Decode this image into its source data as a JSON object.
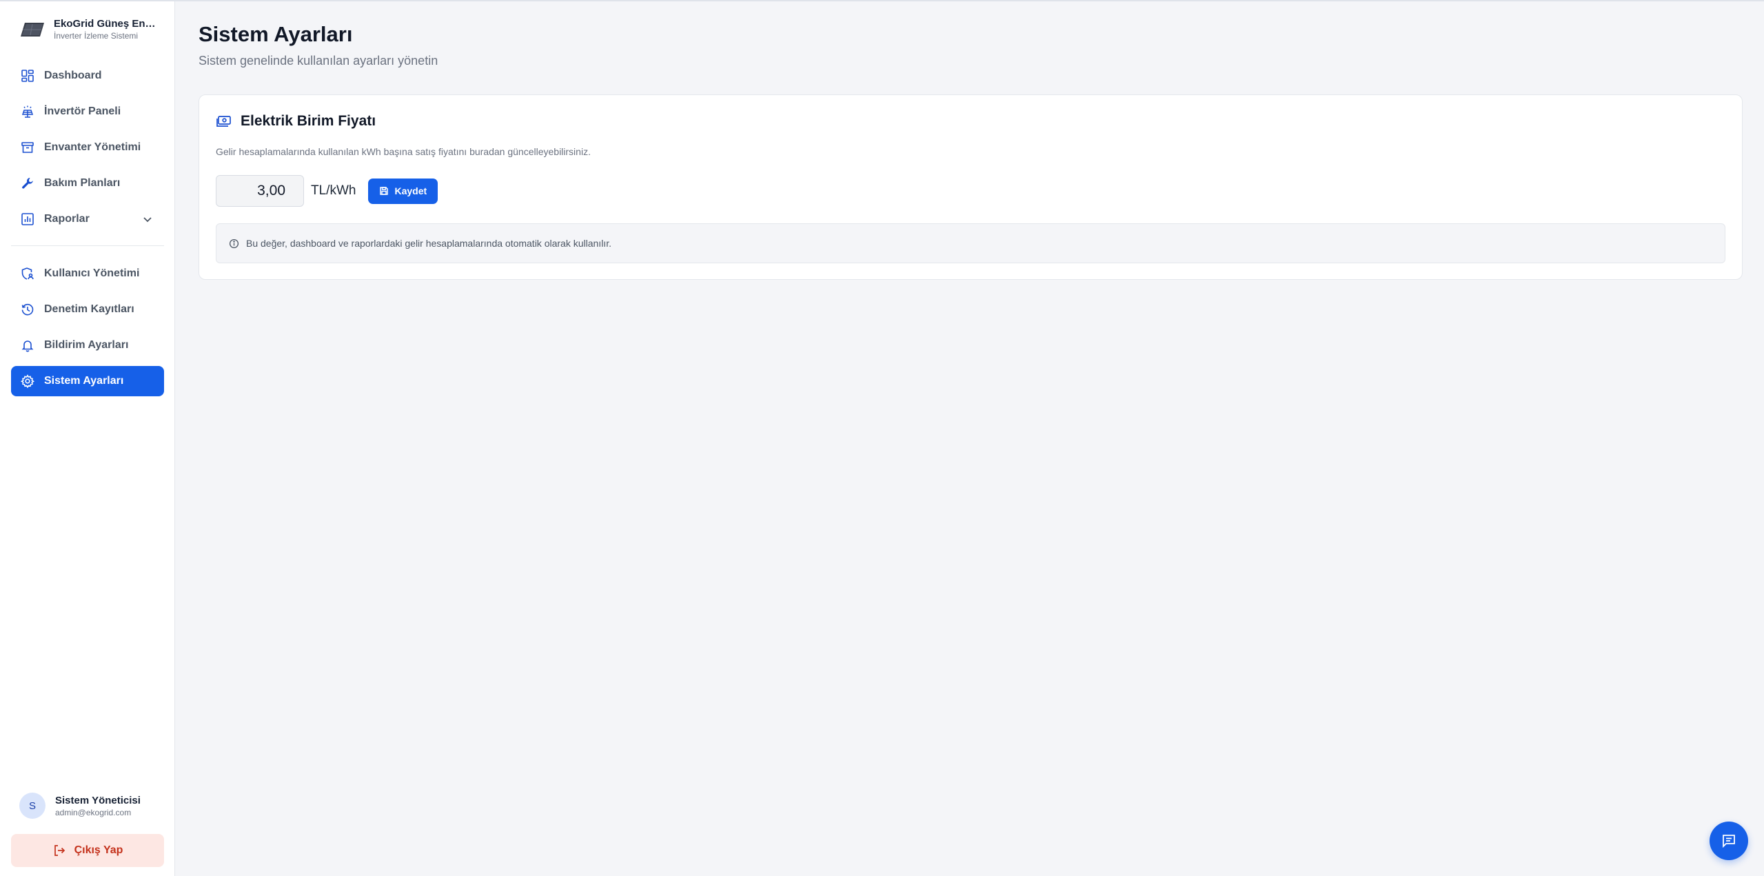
{
  "brand": {
    "title": "EkoGrid Güneş Enerji",
    "subtitle": "İnverter İzleme Sistemi"
  },
  "nav": {
    "items": [
      {
        "label": "Dashboard",
        "icon": "dashboard-icon"
      },
      {
        "label": "İnvertör Paneli",
        "icon": "solar-panel-icon"
      },
      {
        "label": "Envanter Yönetimi",
        "icon": "archive-icon"
      },
      {
        "label": "Bakım Planları",
        "icon": "wrench-icon"
      },
      {
        "label": "Raporlar",
        "icon": "chart-icon"
      }
    ],
    "admin_items": [
      {
        "label": "Kullanıcı Yönetimi",
        "icon": "user-shield-icon"
      },
      {
        "label": "Denetim Kayıtları",
        "icon": "history-icon"
      },
      {
        "label": "Bildirim Ayarları",
        "icon": "bell-icon"
      },
      {
        "label": "Sistem Ayarları",
        "icon": "gear-icon",
        "active": true
      }
    ]
  },
  "user": {
    "initial": "S",
    "name": "Sistem Yöneticisi",
    "email": "admin@ekogrid.com"
  },
  "logout_label": "Çıkış Yap",
  "page": {
    "title": "Sistem Ayarları",
    "subtitle": "Sistem genelinde kullanılan ayarları yönetin"
  },
  "price_card": {
    "title": "Elektrik Birim Fiyatı",
    "description": "Gelir hesaplamalarında kullanılan kWh başına satış fiyatını buradan güncelleyebilirsiniz.",
    "value": "3,00",
    "unit": "TL/kWh",
    "save_label": "Kaydet",
    "note": "Bu değer, dashboard ve raporlardaki gelir hesaplamalarında otomatik olarak kullanılır."
  },
  "colors": {
    "accent": "#1660e8",
    "danger": "#c4321c",
    "danger_bg": "#fde7e3"
  }
}
